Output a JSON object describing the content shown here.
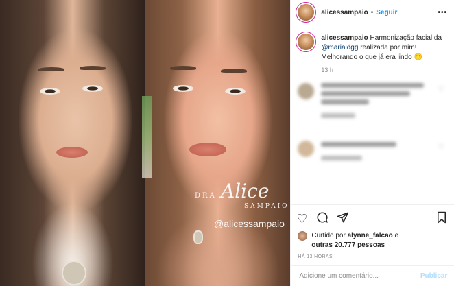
{
  "header": {
    "username": "alicessampaio",
    "separator": "•",
    "follow_label": "Seguir",
    "more_label": "•••"
  },
  "caption": {
    "username": "alicessampaio",
    "text_part1": "Harmonização facial da",
    "mention": "@marialdgg",
    "text_part2": "realizada por mim! Melhorando o que já era lindo",
    "emoji": "🙂",
    "time": "13 h"
  },
  "watermark": {
    "prefix": "DRA",
    "name_script": "Alice",
    "surname": "SAMPAIO",
    "handle": "@alicessampaio"
  },
  "actions": {
    "like_icon": "heart-icon",
    "comment_icon": "comment-icon",
    "share_icon": "send-icon",
    "save_icon": "bookmark-icon",
    "liked_by_prefix": "Curtido por",
    "liked_by_user": "alynne_falcao",
    "liked_by_joiner": "e",
    "others_count": "outras 20.777 pessoas",
    "posted_ago": "HÁ 13 HORAS"
  },
  "add_comment": {
    "placeholder": "Adicione um comentário...",
    "publish_label": "Publicar"
  },
  "colors": {
    "link_blue": "#0095f6",
    "mention_blue": "#00376b",
    "muted": "#8e8e8e",
    "publish_disabled": "#b2dffc"
  }
}
